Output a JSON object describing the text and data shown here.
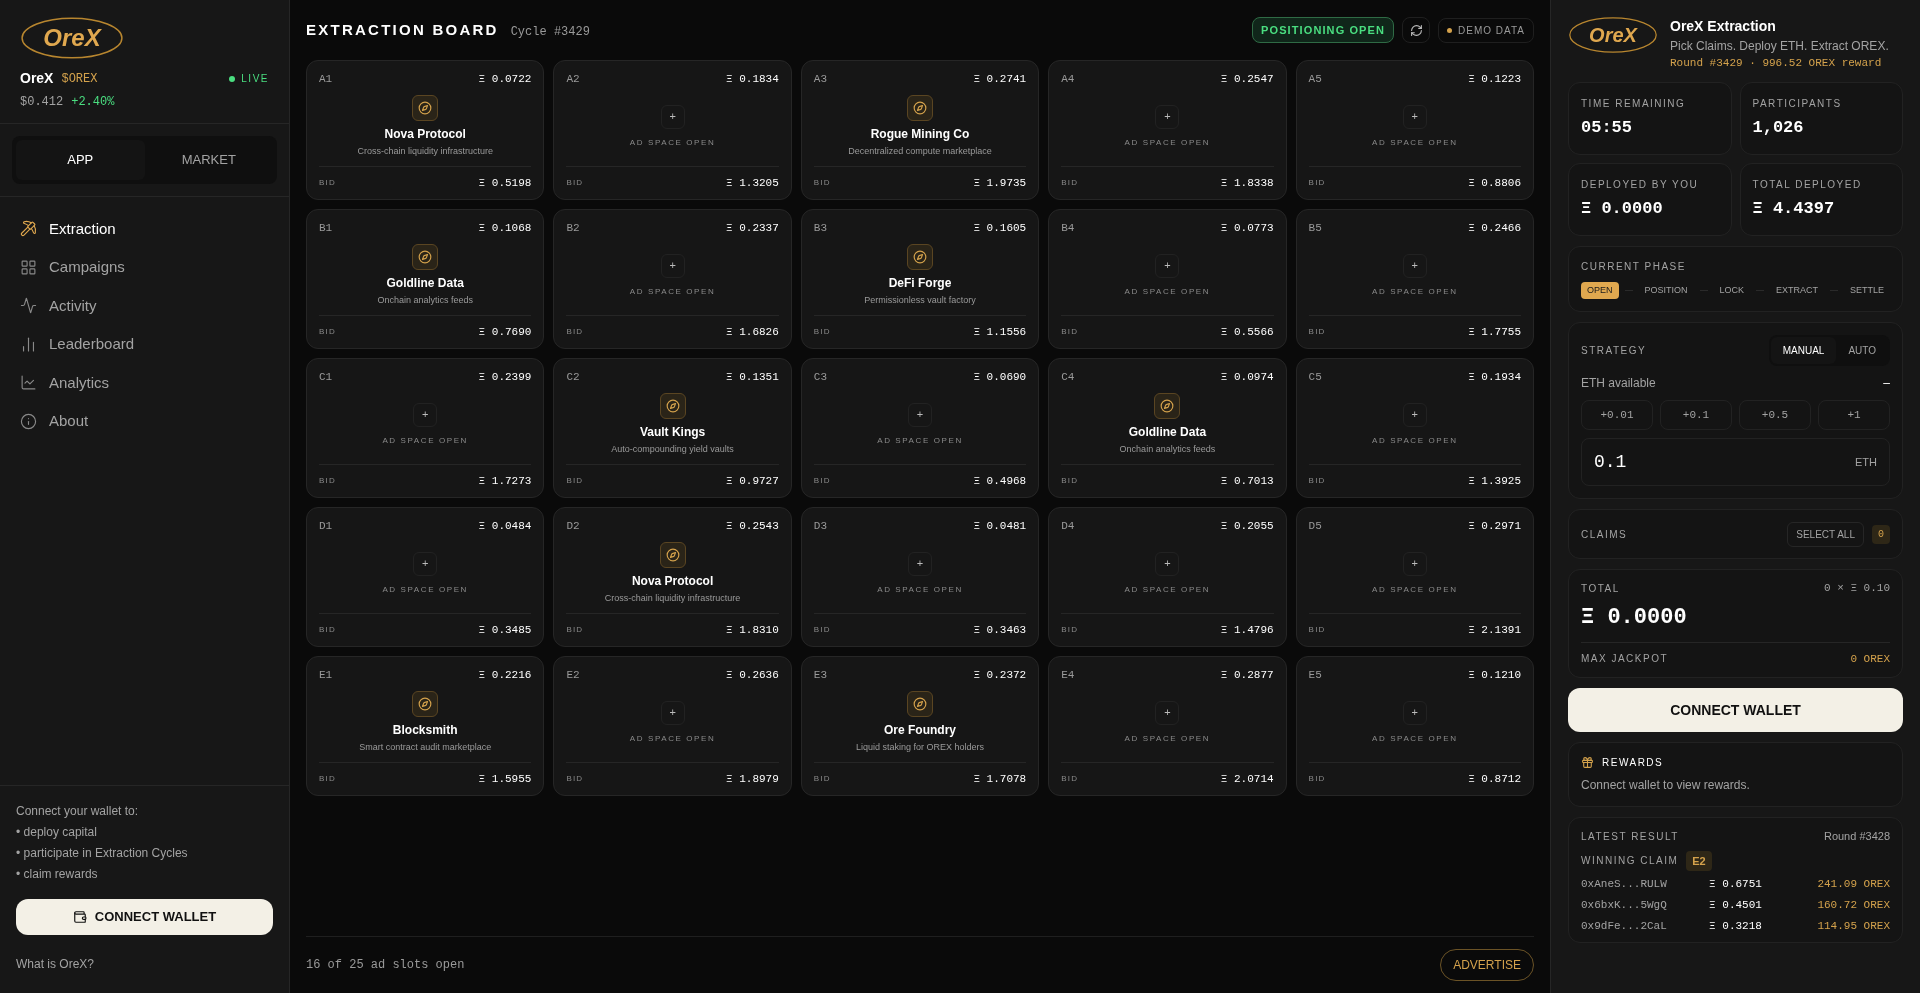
{
  "sidebar": {
    "logo": "OreX",
    "token": {
      "name": "OreX",
      "ticker": "$OREX",
      "price": "$0.412",
      "change": "+2.40%"
    },
    "live": {
      "label": "LIVE",
      "on": true
    },
    "tabs": [
      {
        "label": "APP",
        "selected": true
      },
      {
        "label": "MARKET",
        "selected": false
      }
    ],
    "nav": [
      {
        "label": "Extraction",
        "selected": true
      },
      {
        "label": "Campaigns",
        "selected": false
      },
      {
        "label": "Activity",
        "selected": false
      },
      {
        "label": "Leaderboard",
        "selected": false
      },
      {
        "label": "Analytics",
        "selected": false
      },
      {
        "label": "About",
        "selected": false
      }
    ],
    "connect_intro": "Connect your wallet to:",
    "connect_points": [
      "• deploy capital",
      "• participate in Extraction Cycles",
      "• claim rewards"
    ],
    "connect_button": "CONNECT WALLET",
    "help_link": "What is OreX?"
  },
  "board": {
    "title": "EXTRACTION BOARD",
    "cycle": "Cycle #3429",
    "status": "POSITIONING OPEN",
    "demo": "DEMO DATA",
    "slots": [
      {
        "id": "A1",
        "price": "Ξ 0.0722",
        "kind": "sponsor",
        "name": "Nova Protocol",
        "tagline": "Cross-chain liquidity infrastructure",
        "bid_label": "BID",
        "bid": "Ξ 0.5198"
      },
      {
        "id": "A2",
        "price": "Ξ 0.1834",
        "kind": "open",
        "add": "+",
        "note": "AD SPACE OPEN",
        "bid_label": "BID",
        "bid": "Ξ 1.3205"
      },
      {
        "id": "A3",
        "price": "Ξ 0.2741",
        "kind": "sponsor",
        "name": "Rogue Mining Co",
        "tagline": "Decentralized compute marketplace",
        "bid_label": "BID",
        "bid": "Ξ 1.9735"
      },
      {
        "id": "A4",
        "price": "Ξ 0.2547",
        "kind": "open",
        "add": "+",
        "note": "AD SPACE OPEN",
        "bid_label": "BID",
        "bid": "Ξ 1.8338"
      },
      {
        "id": "A5",
        "price": "Ξ 0.1223",
        "kind": "open",
        "add": "+",
        "note": "AD SPACE OPEN",
        "bid_label": "BID",
        "bid": "Ξ 0.8806"
      },
      {
        "id": "B1",
        "price": "Ξ 0.1068",
        "kind": "sponsor",
        "name": "Goldline Data",
        "tagline": "Onchain analytics feeds",
        "bid_label": "BID",
        "bid": "Ξ 0.7690"
      },
      {
        "id": "B2",
        "price": "Ξ 0.2337",
        "kind": "open",
        "add": "+",
        "note": "AD SPACE OPEN",
        "bid_label": "BID",
        "bid": "Ξ 1.6826"
      },
      {
        "id": "B3",
        "price": "Ξ 0.1605",
        "kind": "sponsor",
        "name": "DeFi Forge",
        "tagline": "Permissionless vault factory",
        "bid_label": "BID",
        "bid": "Ξ 1.1556"
      },
      {
        "id": "B4",
        "price": "Ξ 0.0773",
        "kind": "open",
        "add": "+",
        "note": "AD SPACE OPEN",
        "bid_label": "BID",
        "bid": "Ξ 0.5566"
      },
      {
        "id": "B5",
        "price": "Ξ 0.2466",
        "kind": "open",
        "add": "+",
        "note": "AD SPACE OPEN",
        "bid_label": "BID",
        "bid": "Ξ 1.7755"
      },
      {
        "id": "C1",
        "price": "Ξ 0.2399",
        "kind": "open",
        "add": "+",
        "note": "AD SPACE OPEN",
        "bid_label": "BID",
        "bid": "Ξ 1.7273"
      },
      {
        "id": "C2",
        "price": "Ξ 0.1351",
        "kind": "sponsor",
        "name": "Vault Kings",
        "tagline": "Auto-compounding yield vaults",
        "bid_label": "BID",
        "bid": "Ξ 0.9727"
      },
      {
        "id": "C3",
        "price": "Ξ 0.0690",
        "kind": "open",
        "add": "+",
        "note": "AD SPACE OPEN",
        "bid_label": "BID",
        "bid": "Ξ 0.4968"
      },
      {
        "id": "C4",
        "price": "Ξ 0.0974",
        "kind": "sponsor",
        "name": "Goldline Data",
        "tagline": "Onchain analytics feeds",
        "bid_label": "BID",
        "bid": "Ξ 0.7013"
      },
      {
        "id": "C5",
        "price": "Ξ 0.1934",
        "kind": "open",
        "add": "+",
        "note": "AD SPACE OPEN",
        "bid_label": "BID",
        "bid": "Ξ 1.3925"
      },
      {
        "id": "D1",
        "price": "Ξ 0.0484",
        "kind": "open",
        "add": "+",
        "note": "AD SPACE OPEN",
        "bid_label": "BID",
        "bid": "Ξ 0.3485"
      },
      {
        "id": "D2",
        "price": "Ξ 0.2543",
        "kind": "sponsor",
        "name": "Nova Protocol",
        "tagline": "Cross-chain liquidity infrastructure",
        "bid_label": "BID",
        "bid": "Ξ 1.8310"
      },
      {
        "id": "D3",
        "price": "Ξ 0.0481",
        "kind": "open",
        "add": "+",
        "note": "AD SPACE OPEN",
        "bid_label": "BID",
        "bid": "Ξ 0.3463"
      },
      {
        "id": "D4",
        "price": "Ξ 0.2055",
        "kind": "open",
        "add": "+",
        "note": "AD SPACE OPEN",
        "bid_label": "BID",
        "bid": "Ξ 1.4796"
      },
      {
        "id": "D5",
        "price": "Ξ 0.2971",
        "kind": "open",
        "add": "+",
        "note": "AD SPACE OPEN",
        "bid_label": "BID",
        "bid": "Ξ 2.1391"
      },
      {
        "id": "E1",
        "price": "Ξ 0.2216",
        "kind": "sponsor",
        "name": "Blocksmith",
        "tagline": "Smart contract audit marketplace",
        "bid_label": "BID",
        "bid": "Ξ 1.5955"
      },
      {
        "id": "E2",
        "price": "Ξ 0.2636",
        "kind": "open",
        "add": "+",
        "note": "AD SPACE OPEN",
        "bid_label": "BID",
        "bid": "Ξ 1.8979"
      },
      {
        "id": "E3",
        "price": "Ξ 0.2372",
        "kind": "sponsor",
        "name": "Ore Foundry",
        "tagline": "Liquid staking for OREX holders",
        "bid_label": "BID",
        "bid": "Ξ 1.7078"
      },
      {
        "id": "E4",
        "price": "Ξ 0.2877",
        "kind": "open",
        "add": "+",
        "note": "AD SPACE OPEN",
        "bid_label": "BID",
        "bid": "Ξ 2.0714"
      },
      {
        "id": "E5",
        "price": "Ξ 0.1210",
        "kind": "open",
        "add": "+",
        "note": "AD SPACE OPEN",
        "bid_label": "BID",
        "bid": "Ξ 0.8712"
      }
    ],
    "footer": "16 of 25 ad slots open",
    "advertise": "ADVERTISE"
  },
  "panel": {
    "logo": "OreX",
    "title": "OreX Extraction",
    "subtitle": "Pick Claims. Deploy ETH. Extract OREX.",
    "round": "Round #3429 · 996.52 OREX reward",
    "stats": [
      {
        "label": "TIME REMAINING",
        "value": "05:55"
      },
      {
        "label": "PARTICIPANTS",
        "value": "1,026"
      },
      {
        "label": "DEPLOYED BY YOU",
        "value": "Ξ 0.0000"
      },
      {
        "label": "TOTAL DEPLOYED",
        "value": "Ξ 4.4397"
      }
    ],
    "phase": {
      "label": "CURRENT PHASE",
      "steps": [
        {
          "label": "OPEN",
          "selected": true
        },
        {
          "label": "POSITION",
          "selected": false
        },
        {
          "label": "LOCK",
          "selected": false
        },
        {
          "label": "EXTRACT",
          "selected": false
        },
        {
          "label": "SETTLE",
          "selected": false
        }
      ]
    },
    "strategy": {
      "label": "STRATEGY",
      "modes": [
        {
          "label": "MANUAL",
          "selected": true
        },
        {
          "label": "AUTO",
          "selected": false
        }
      ],
      "eth_label": "ETH available",
      "eth_value": "–",
      "increments": [
        "+0.01",
        "+0.1",
        "+0.5",
        "+1"
      ],
      "amount": "0.1",
      "unit": "ETH"
    },
    "claims": {
      "label": "CLAIMS",
      "select_all": "SELECT ALL",
      "count": "0"
    },
    "total": {
      "label": "TOTAL",
      "formula": "0 × Ξ 0.10",
      "value": "Ξ 0.0000",
      "jackpot_label": "MAX JACKPOT",
      "jackpot": "0 OREX"
    },
    "connect_button": "CONNECT WALLET",
    "rewards": {
      "title": "REWARDS",
      "text": "Connect wallet to view rewards."
    },
    "latest": {
      "label": "LATEST RESULT",
      "round": "Round #3428",
      "winning_label": "WINNING CLAIM",
      "winning": "E2",
      "rows": [
        {
          "address": "0xAneS...RULW",
          "eth": "Ξ 0.6751",
          "reward": "241.09 OREX"
        },
        {
          "address": "0x6bxK...5WgQ",
          "eth": "Ξ 0.4501",
          "reward": "160.72 OREX"
        },
        {
          "address": "0x9dFe...2CaL",
          "eth": "Ξ 0.3218",
          "reward": "114.95 OREX"
        }
      ]
    }
  }
}
